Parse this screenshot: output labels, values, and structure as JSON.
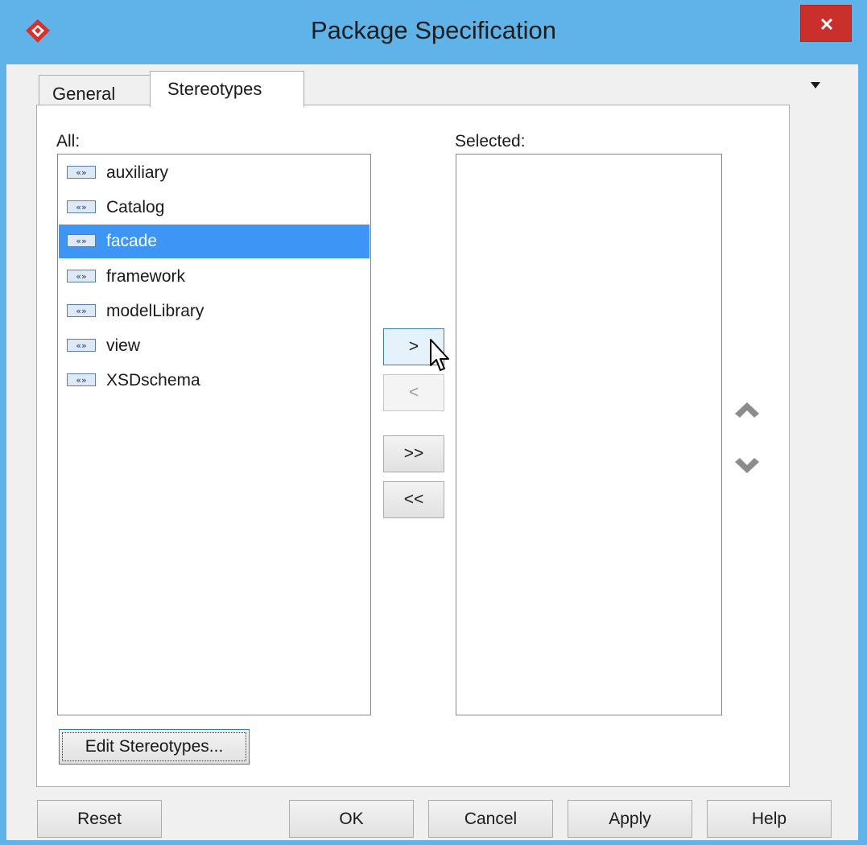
{
  "window": {
    "title": "Package Specification",
    "close_icon": "close-icon",
    "accent_color": "#5fb3e8",
    "close_color": "#c9302c"
  },
  "tabs": [
    {
      "label": "General",
      "active": false
    },
    {
      "label": "Stereotypes",
      "active": true
    }
  ],
  "stereotypes": {
    "all_label": "All:",
    "selected_label": "Selected:",
    "all_items": [
      {
        "label": "auxiliary",
        "icon": "stereotype-icon",
        "selected": false
      },
      {
        "label": "Catalog",
        "icon": "stereotype-icon",
        "selected": false
      },
      {
        "label": "facade",
        "icon": "stereotype-icon",
        "selected": true
      },
      {
        "label": "framework",
        "icon": "stereotype-icon",
        "selected": false
      },
      {
        "label": "modelLibrary",
        "icon": "stereotype-icon",
        "selected": false
      },
      {
        "label": "view",
        "icon": "stereotype-icon",
        "selected": false
      },
      {
        "label": "XSDschema",
        "icon": "stereotype-icon",
        "selected": false
      }
    ],
    "selected_items": [],
    "add_label": ">",
    "remove_label": "<",
    "add_all_label": ">>",
    "remove_all_label": "<<",
    "edit_label": "Edit Stereotypes..."
  },
  "footer": {
    "reset": "Reset",
    "ok": "OK",
    "cancel": "Cancel",
    "apply": "Apply",
    "help": "Help"
  },
  "selection_color": "#3d96f5"
}
